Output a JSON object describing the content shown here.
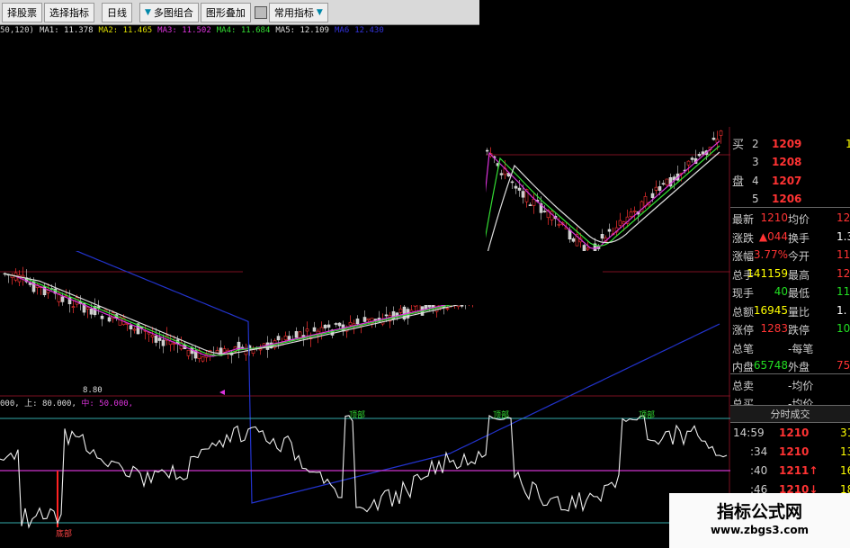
{
  "toolbar": {
    "buttons": [
      {
        "label": "择股票"
      },
      {
        "label": "选择指标"
      },
      {
        "label": "日线"
      },
      {
        "label": "多图组合"
      },
      {
        "label": "图形叠加"
      },
      {
        "label": "常用指标"
      }
    ]
  },
  "ma_line": {
    "params": "50,120)",
    "ma1": "MA1: 11.378",
    "ma2": "MA2: 11.465",
    "ma3": "MA3: 11.502",
    "ma4": "MA4: 11.684",
    "ma5": "MA5: 12.109",
    "ma6": "MA6",
    "ma6_value": "12.430",
    "colors": {
      "ma1": "#dddddd",
      "ma2": "#dddd00",
      "ma3": "#dd33dd",
      "ma4": "#33dd33",
      "ma5": "#dddddd",
      "ma6": "#3333dd"
    }
  },
  "price_chart": {
    "low_label": "8.80"
  },
  "oscillator": {
    "header_prefix": "000,",
    "header_upper": "上: 80.000,",
    "header_mid": "中: 50.000,",
    "labels": {
      "top1": "顶部",
      "top2": "顶部",
      "top3": "顶部",
      "bottom": "底部"
    }
  },
  "right_panel": {
    "buy_label_1": "买",
    "buy_label_2": "盘",
    "buy_rows": [
      {
        "idx": "2",
        "price": "1209",
        "vol": "1"
      },
      {
        "idx": "3",
        "price": "1208",
        "vol": ""
      },
      {
        "idx": "4",
        "price": "1207",
        "vol": ""
      },
      {
        "idx": "5",
        "price": "1206",
        "vol": ""
      }
    ],
    "stats": [
      {
        "l1": "最新",
        "v1": "1210",
        "l2": "均价",
        "v2": "12"
      },
      {
        "l1": "涨跌",
        "v1": "▲044",
        "l2": "换手",
        "v2": "1.3"
      },
      {
        "l1": "涨幅",
        "v1": "3.77%",
        "l2": "今开",
        "v2": "11"
      },
      {
        "l1": "总手",
        "v1": "141159",
        "l2": "最高",
        "v2": "12"
      },
      {
        "l1": "现手",
        "v1": "40",
        "l2": "最低",
        "v2": "11"
      },
      {
        "l1": "总额",
        "v1": "16945",
        "l2": "量比",
        "v2": "1."
      },
      {
        "l1": "涨停",
        "v1": "1283",
        "l2": "跌停",
        "v2": "10"
      },
      {
        "l1": "总笔",
        "v1": "",
        "l2": "-每笔",
        "v2": ""
      },
      {
        "l1": "内盘",
        "v1": "65748",
        "l2": "外盘",
        "v2": "754"
      },
      {
        "l1": "总卖",
        "v1": "",
        "l2": "-均价",
        "v2": ""
      },
      {
        "l1": "总买",
        "v1": "",
        "l2": "-均价",
        "v2": ""
      }
    ],
    "ticks_header": "分时成交",
    "ticks": [
      {
        "time": "14:59",
        "price": "1210",
        "vol": "31"
      },
      {
        "time": ":34",
        "price": "1210",
        "vol": "13"
      },
      {
        "time": ":40",
        "price": "1211↑",
        "vol": "16"
      },
      {
        "time": ":46",
        "price": "1210↓",
        "vol": "18"
      }
    ]
  },
  "watermark": {
    "title": "指标公式网",
    "url": "www.zbgs3.com"
  }
}
